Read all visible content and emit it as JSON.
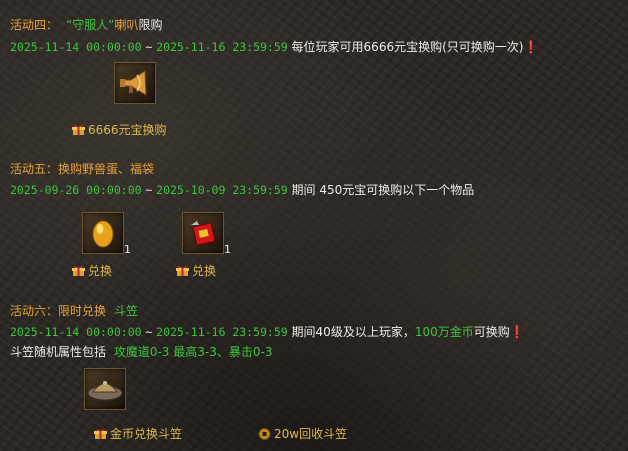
{
  "events": [
    {
      "title_label": "活动四：",
      "title_quote": "“守服人”",
      "title_item": "喇叭",
      "title_suffix": "限购",
      "date_start": "2025-11-14 00:00:00",
      "tilde": "~",
      "date_end": "2025-11-16 23:59:59",
      "desc": "每位玩家可用6666元宝换购(只可换购一次)❗",
      "button": "6666元宝换购"
    },
    {
      "title_label": "活动五：",
      "title_item": "换购野兽蛋、福袋",
      "date_start": "2025-09-26 00:00:00",
      "tilde": "~",
      "date_end": "2025-10-09 23:59:59",
      "desc": "期间 450元宝可换购以下一个物品",
      "items": [
        {
          "qty": "1",
          "icon": "beast-egg-icon",
          "button": "兑换"
        },
        {
          "qty": "1",
          "icon": "lucky-bag-icon",
          "button": "兑换"
        }
      ]
    },
    {
      "title_label": "活动六：",
      "title_item": "限时兑换",
      "title_item2": "斗笠",
      "date_start": "2025-11-14 00:00:00",
      "tilde": "~",
      "date_end": "2025-11-16 23:59:59",
      "desc_a": "期间40级及以上玩家，",
      "desc_b": "100万金币",
      "desc_c": "可换购❗",
      "attr_label": "斗笠随机属性包括",
      "attr_values": "攻魔道0-3 最高3-3、暴击0-3",
      "button1": "金币兑换斗笠",
      "button2": "20w回收斗笠"
    }
  ],
  "colors": {
    "green": "#3ec43e",
    "orange": "#e8a238",
    "gold": "#e0b84a",
    "white": "#ececec"
  }
}
